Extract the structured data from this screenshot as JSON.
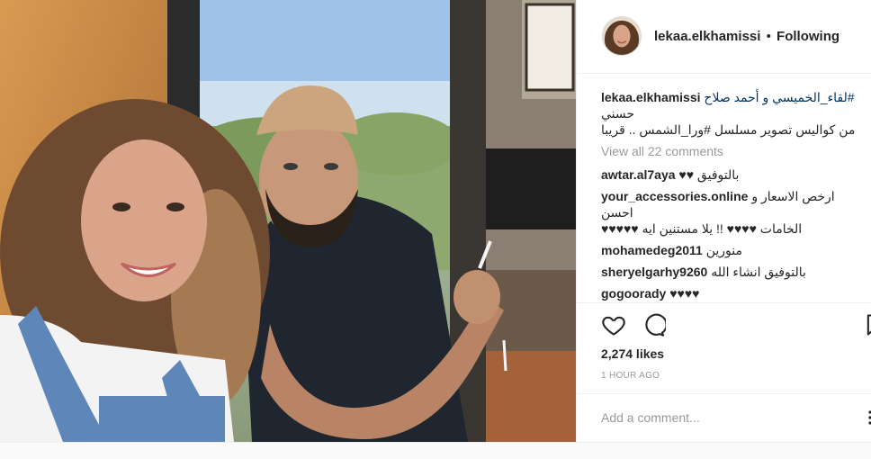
{
  "post": {
    "username": "lekaa.elkhamissi",
    "separator": "•",
    "follow_status": "Following",
    "caption": {
      "username": "lekaa.elkhamissi",
      "line1": "#لقاء_الخميسي و أحمد صلاح",
      "line2": "حسني",
      "line3": "من كواليس تصوير مسلسل #ورا_الشمس .. قريبا"
    },
    "view_all_comments": "View all 22 comments",
    "comments": [
      {
        "username": "awtar.al7aya",
        "text": "بالتوفيق ♥♥"
      },
      {
        "username": "your_accessories.online",
        "text": "ارخص الاسعار و احسن",
        "text2": "الخامات ♥♥♥♥ !! يلا مستنين ايه ♥♥♥♥♥"
      },
      {
        "username": "mohamedeg2011",
        "text": "منورين"
      },
      {
        "username": "sheryelgarhy9260",
        "text": "بالتوفيق انشاء الله"
      },
      {
        "username": "gogoorady",
        "text": "♥♥♥♥"
      }
    ],
    "likes": "2,274 likes",
    "time_ago": "1 HOUR AGO",
    "add_comment_placeholder": "Add a comment..."
  },
  "icons": {
    "like": "heart-icon",
    "comment": "comment-bubble-icon",
    "save": "bookmark-icon",
    "more": "more-options-icon"
  },
  "colors": {
    "text": "#262626",
    "muted": "#999999",
    "hashtag": "#003569",
    "border": "#efefef"
  }
}
